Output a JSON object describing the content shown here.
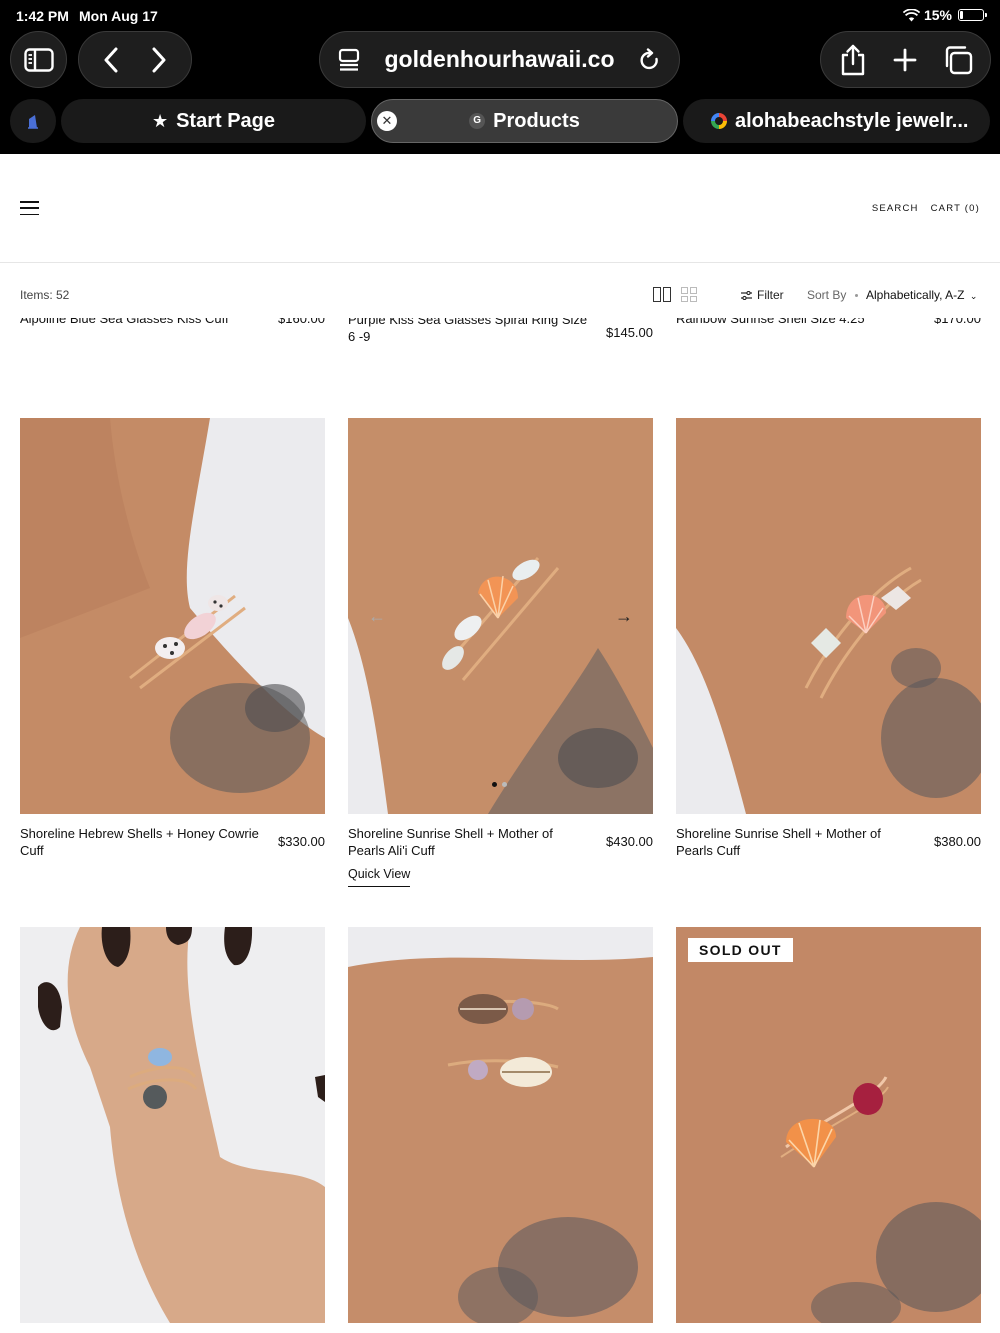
{
  "status": {
    "time": "1:42 PM",
    "date": "Mon Aug 17",
    "battery": "15%",
    "battery_level": 0.15
  },
  "browser": {
    "url": "goldenhourhawaii.co",
    "tabs": [
      {
        "label": "Start Page",
        "icon": "star-icon"
      },
      {
        "label": "Products",
        "icon": "g-favicon",
        "active": true
      },
      {
        "label": "alohabeachstyle jewelr...",
        "icon": "google-favicon"
      }
    ],
    "favicon_letter": "G"
  },
  "header": {
    "search_label": "SEARCH",
    "cart_label": "CART (0)"
  },
  "toolbar": {
    "items_count": "Items: 52",
    "filter_label": "Filter",
    "sort_label": "Sort By",
    "sort_value": "Alphabetically, A-Z"
  },
  "partial_row": [
    {
      "title": "Alpoline Blue Sea Glasses Kiss Cuff",
      "price": "$160.00"
    },
    {
      "title": "Purple Kiss Sea Glasses Spiral Ring Size 6 -9",
      "price": "$145.00"
    },
    {
      "title": "Rainbow Sunrise Shell Size 4.25",
      "price": "$170.00"
    }
  ],
  "products": [
    {
      "title": "Shoreline Hebrew Shells + Honey Cowrie Cuff",
      "price": "$330.00"
    },
    {
      "title": "Shoreline Sunrise Shell + Mother of Pearls Ali'i Cuff",
      "price": "$430.00",
      "quick_view": "Quick View"
    },
    {
      "title": "Shoreline Sunrise Shell + Mother of Pearls Cuff",
      "price": "$380.00"
    },
    {
      "title": "",
      "price": ""
    },
    {
      "title": "",
      "price": ""
    },
    {
      "title": "",
      "price": "",
      "badge": "SOLD OUT"
    }
  ],
  "colors": {
    "chrome_bg": "#000000",
    "skin": "#c9906c",
    "gold": "#d9a57a",
    "sunrise_shell": "#f08a4b"
  }
}
